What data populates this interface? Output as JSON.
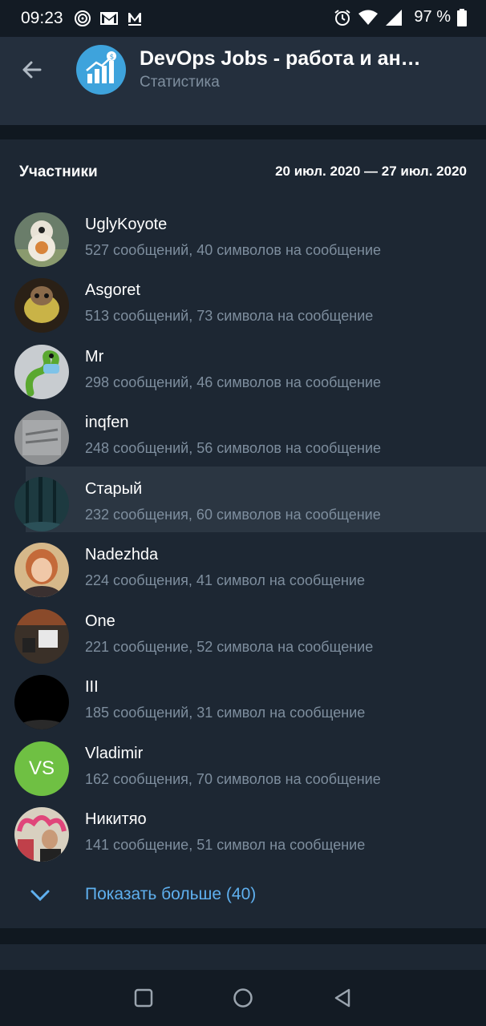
{
  "status_bar": {
    "time": "09:23",
    "battery": "97 %"
  },
  "header": {
    "title": "DevOps Jobs - работа и ан…",
    "subtitle": "Статистика"
  },
  "members": {
    "title": "Участники",
    "range": "20 июл. 2020 — 27 июл. 2020",
    "items": [
      {
        "name": "UglyKoyote",
        "stats": "527 сообщений, 40 символов на сообщение"
      },
      {
        "name": "Asgoret",
        "stats": "513 сообщений, 73 символа на сообщение"
      },
      {
        "name": "Mr",
        "stats": "298 сообщений, 46 символов на сообщение"
      },
      {
        "name": "inqfen",
        "stats": "248 сообщений, 56 символов на сообщение"
      },
      {
        "name": "Старый",
        "stats": "232 сообщения, 60 символов на сообщение"
      },
      {
        "name": "Nadezhda",
        "stats": "224 сообщения, 41 символ на сообщение"
      },
      {
        "name": "One",
        "stats": "221 сообщение, 52 символа на сообщение"
      },
      {
        "name": "III",
        "stats": "185 сообщений, 31 символ на сообщение"
      },
      {
        "name": "Vladimir",
        "stats": "162 сообщения, 70 символов на сообщение",
        "initials": "VS"
      },
      {
        "name": "Никитяо",
        "stats": "141 сообщение, 51 символ на сообщение"
      }
    ],
    "show_more": "Показать больше (40)"
  },
  "colors": {
    "accent": "#5fb0ef",
    "vs_avatar": "#6fc043"
  }
}
